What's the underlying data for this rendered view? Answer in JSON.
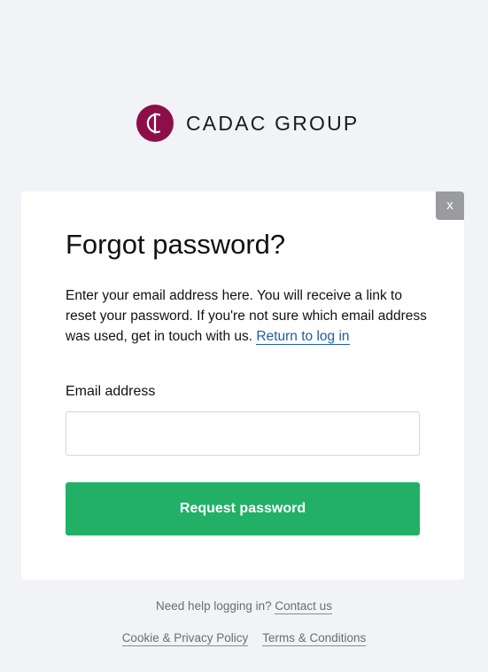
{
  "brand": {
    "name": "CADAC GROUP",
    "color": "#8c0f4a",
    "logo_icon": "cadac-logo-icon"
  },
  "dialog": {
    "close_label": "x",
    "title": "Forgot password?",
    "description": "Enter your email address here. You will receive a link to reset your password. If you're not sure which email address was used, get in touch with us.",
    "return_link": "Return to log in",
    "email_label": "Email address",
    "email_value": "",
    "submit_label": "Request password",
    "submit_color": "#21b066"
  },
  "footer": {
    "help_text": "Need help logging in?",
    "contact_link": "Contact us",
    "cookie_link": "Cookie & Privacy Policy",
    "terms_link": "Terms & Conditions"
  }
}
